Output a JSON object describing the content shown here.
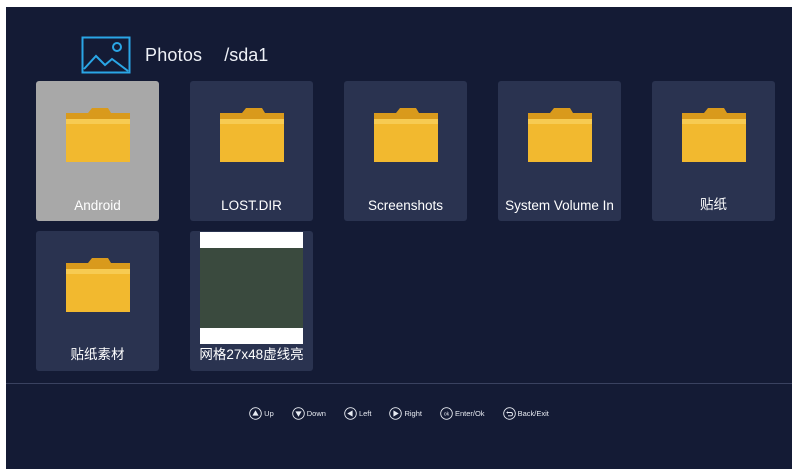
{
  "header": {
    "title": "Photos",
    "path": "/sda1",
    "icon": "photos-icon",
    "accent_color": "#2aa6e6"
  },
  "items": [
    {
      "label": "Android",
      "type": "folder",
      "selected": true,
      "icon": "folder-icon"
    },
    {
      "label": "LOST.DIR",
      "type": "folder",
      "selected": false,
      "icon": "folder-icon"
    },
    {
      "label": "Screenshots",
      "type": "folder",
      "selected": false,
      "icon": "folder-icon"
    },
    {
      "label": "System Volume In",
      "type": "folder",
      "selected": false,
      "icon": "folder-icon"
    },
    {
      "label": "贴纸",
      "type": "folder",
      "selected": false,
      "icon": "folder-icon"
    },
    {
      "label": "贴纸素材",
      "type": "folder",
      "selected": false,
      "icon": "folder-icon"
    },
    {
      "label": "网格27x48虚线亮",
      "type": "image",
      "selected": false,
      "icon": "image-thumbnail"
    }
  ],
  "help_bar": [
    {
      "key": "up-arrow-icon",
      "label": "Up"
    },
    {
      "key": "down-arrow-icon",
      "label": "Down"
    },
    {
      "key": "left-arrow-icon",
      "label": "Left"
    },
    {
      "key": "right-arrow-icon",
      "label": "Right"
    },
    {
      "key": "ok-icon",
      "label": "Enter/Ok"
    },
    {
      "key": "back-icon",
      "label": "Back/Exit"
    }
  ],
  "colors": {
    "background": "#141b35",
    "tile": "#2a3350",
    "tile_selected": "#a8a8a8",
    "folder": "#f2b92f"
  }
}
